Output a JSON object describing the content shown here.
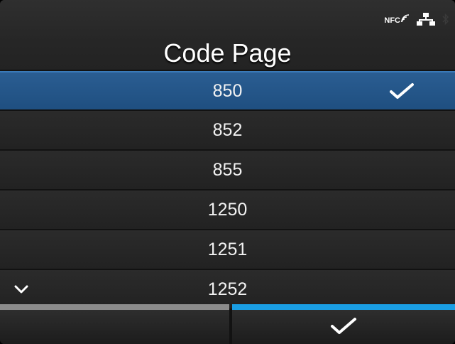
{
  "header": {
    "title": "Code Page",
    "nfc_label": "NFC",
    "icons": [
      "nfc-icon",
      "network-icon",
      "bluetooth-icon"
    ]
  },
  "list": {
    "items": [
      {
        "label": "850",
        "selected": true
      },
      {
        "label": "852",
        "selected": false
      },
      {
        "label": "855",
        "selected": false
      },
      {
        "label": "1250",
        "selected": false
      },
      {
        "label": "1251",
        "selected": false
      },
      {
        "label": "1252",
        "selected": false
      }
    ],
    "selected_icon": "checkmark-icon",
    "more_icon": "chevron-down-icon"
  },
  "footer": {
    "left_button": "",
    "right_button_icon": "checkmark-icon"
  },
  "colors": {
    "selected_row": "#2a5d92",
    "confirm_accent": "#1a9ee4",
    "cancel_accent": "#8c8c8c"
  }
}
